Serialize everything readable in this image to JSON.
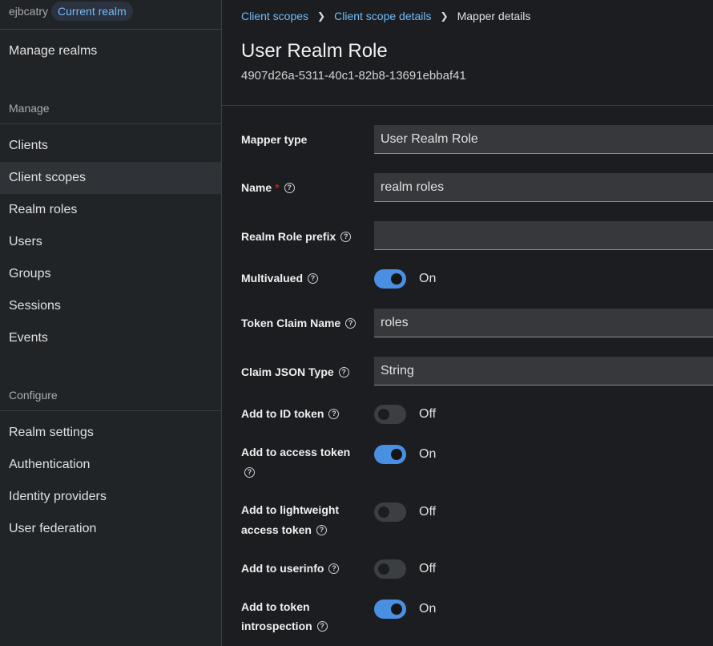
{
  "sidebar": {
    "realm_name": "ejbcatry",
    "realm_badge": "Current realm",
    "manage_realms": "Manage realms",
    "manage_title": "Manage",
    "manage_items": [
      "Clients",
      "Client scopes",
      "Realm roles",
      "Users",
      "Groups",
      "Sessions",
      "Events"
    ],
    "configure_title": "Configure",
    "configure_items": [
      "Realm settings",
      "Authentication",
      "Identity providers",
      "User federation"
    ],
    "active_item": "Client scopes"
  },
  "breadcrumb": {
    "items": [
      "Client scopes",
      "Client scope details"
    ],
    "current": "Mapper details"
  },
  "header": {
    "title": "User Realm Role",
    "id": "4907d26a-5311-40c1-82b8-13691ebbaf41"
  },
  "form": {
    "mapper_type": {
      "label": "Mapper type",
      "value": "User Realm Role"
    },
    "name": {
      "label": "Name",
      "required_mark": "*",
      "value": "realm roles"
    },
    "realm_role_prefix": {
      "label": "Realm Role prefix",
      "value": ""
    },
    "multivalued": {
      "label": "Multivalued",
      "state": "On"
    },
    "token_claim_name": {
      "label": "Token Claim Name",
      "value": "roles"
    },
    "claim_json_type": {
      "label": "Claim JSON Type",
      "value": "String"
    },
    "add_to_id_token": {
      "label": "Add to ID token",
      "state": "Off"
    },
    "add_to_access_token": {
      "label": "Add to access token",
      "state": "On"
    },
    "add_to_lightweight": {
      "label_line1": "Add to lightweight",
      "label_line2": "access token",
      "state": "Off"
    },
    "add_to_userinfo": {
      "label": "Add to userinfo",
      "state": "Off"
    },
    "add_to_introspection": {
      "label_line1": "Add to token",
      "label_line2": "introspection",
      "state": "On"
    }
  },
  "icons": {
    "help": "question-circle-icon",
    "separator": "chevron-right-icon"
  },
  "colors": {
    "accent": "#73bcf7",
    "toggle_on": "#4a90e2",
    "required": "#c9190b"
  }
}
